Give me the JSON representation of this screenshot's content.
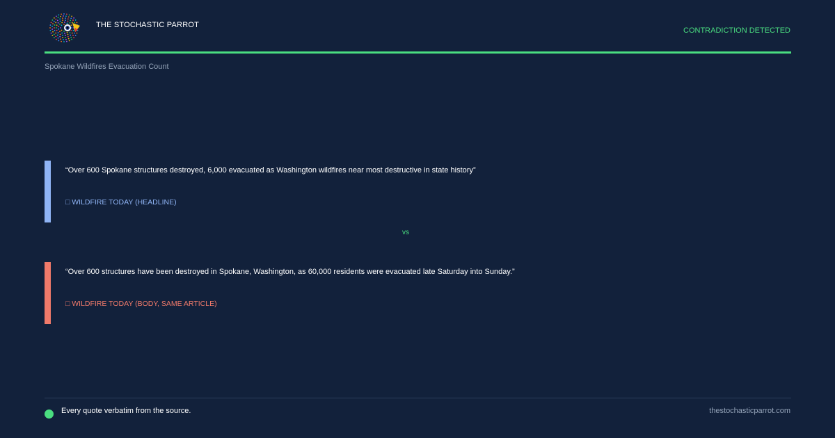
{
  "header": {
    "brand": "THE STOCHASTIC PARROT",
    "status": "CONTRADICTION DETECTED"
  },
  "topic": "Spokane Wildfires Evacuation Count",
  "claims": [
    {
      "quote": "“Over 600 Spokane structures destroyed, 6,000 evacuated as Washington wildfires near most destructive in state history”",
      "source_icon": "□",
      "source": "WILDFIRE TODAY (HEADLINE)",
      "color": "#8fb4f5"
    },
    {
      "quote": "“Over 600 structures have been destroyed in Spokane, Washington, as 60,000 residents were evacuated late Saturday into Sunday.”",
      "source_icon": "□",
      "source": "WILDFIRE TODAY (BODY, SAME ARTICLE)",
      "color": "#f07a6a"
    }
  ],
  "vs_label": "vs",
  "footer": {
    "note": "Every quote verbatim from the source.",
    "site": "thestochasticparrot.com"
  },
  "colors": {
    "background": "#12213b",
    "accent": "#4ade80",
    "claim_a": "#8fb4f5",
    "claim_b": "#f07a6a"
  }
}
